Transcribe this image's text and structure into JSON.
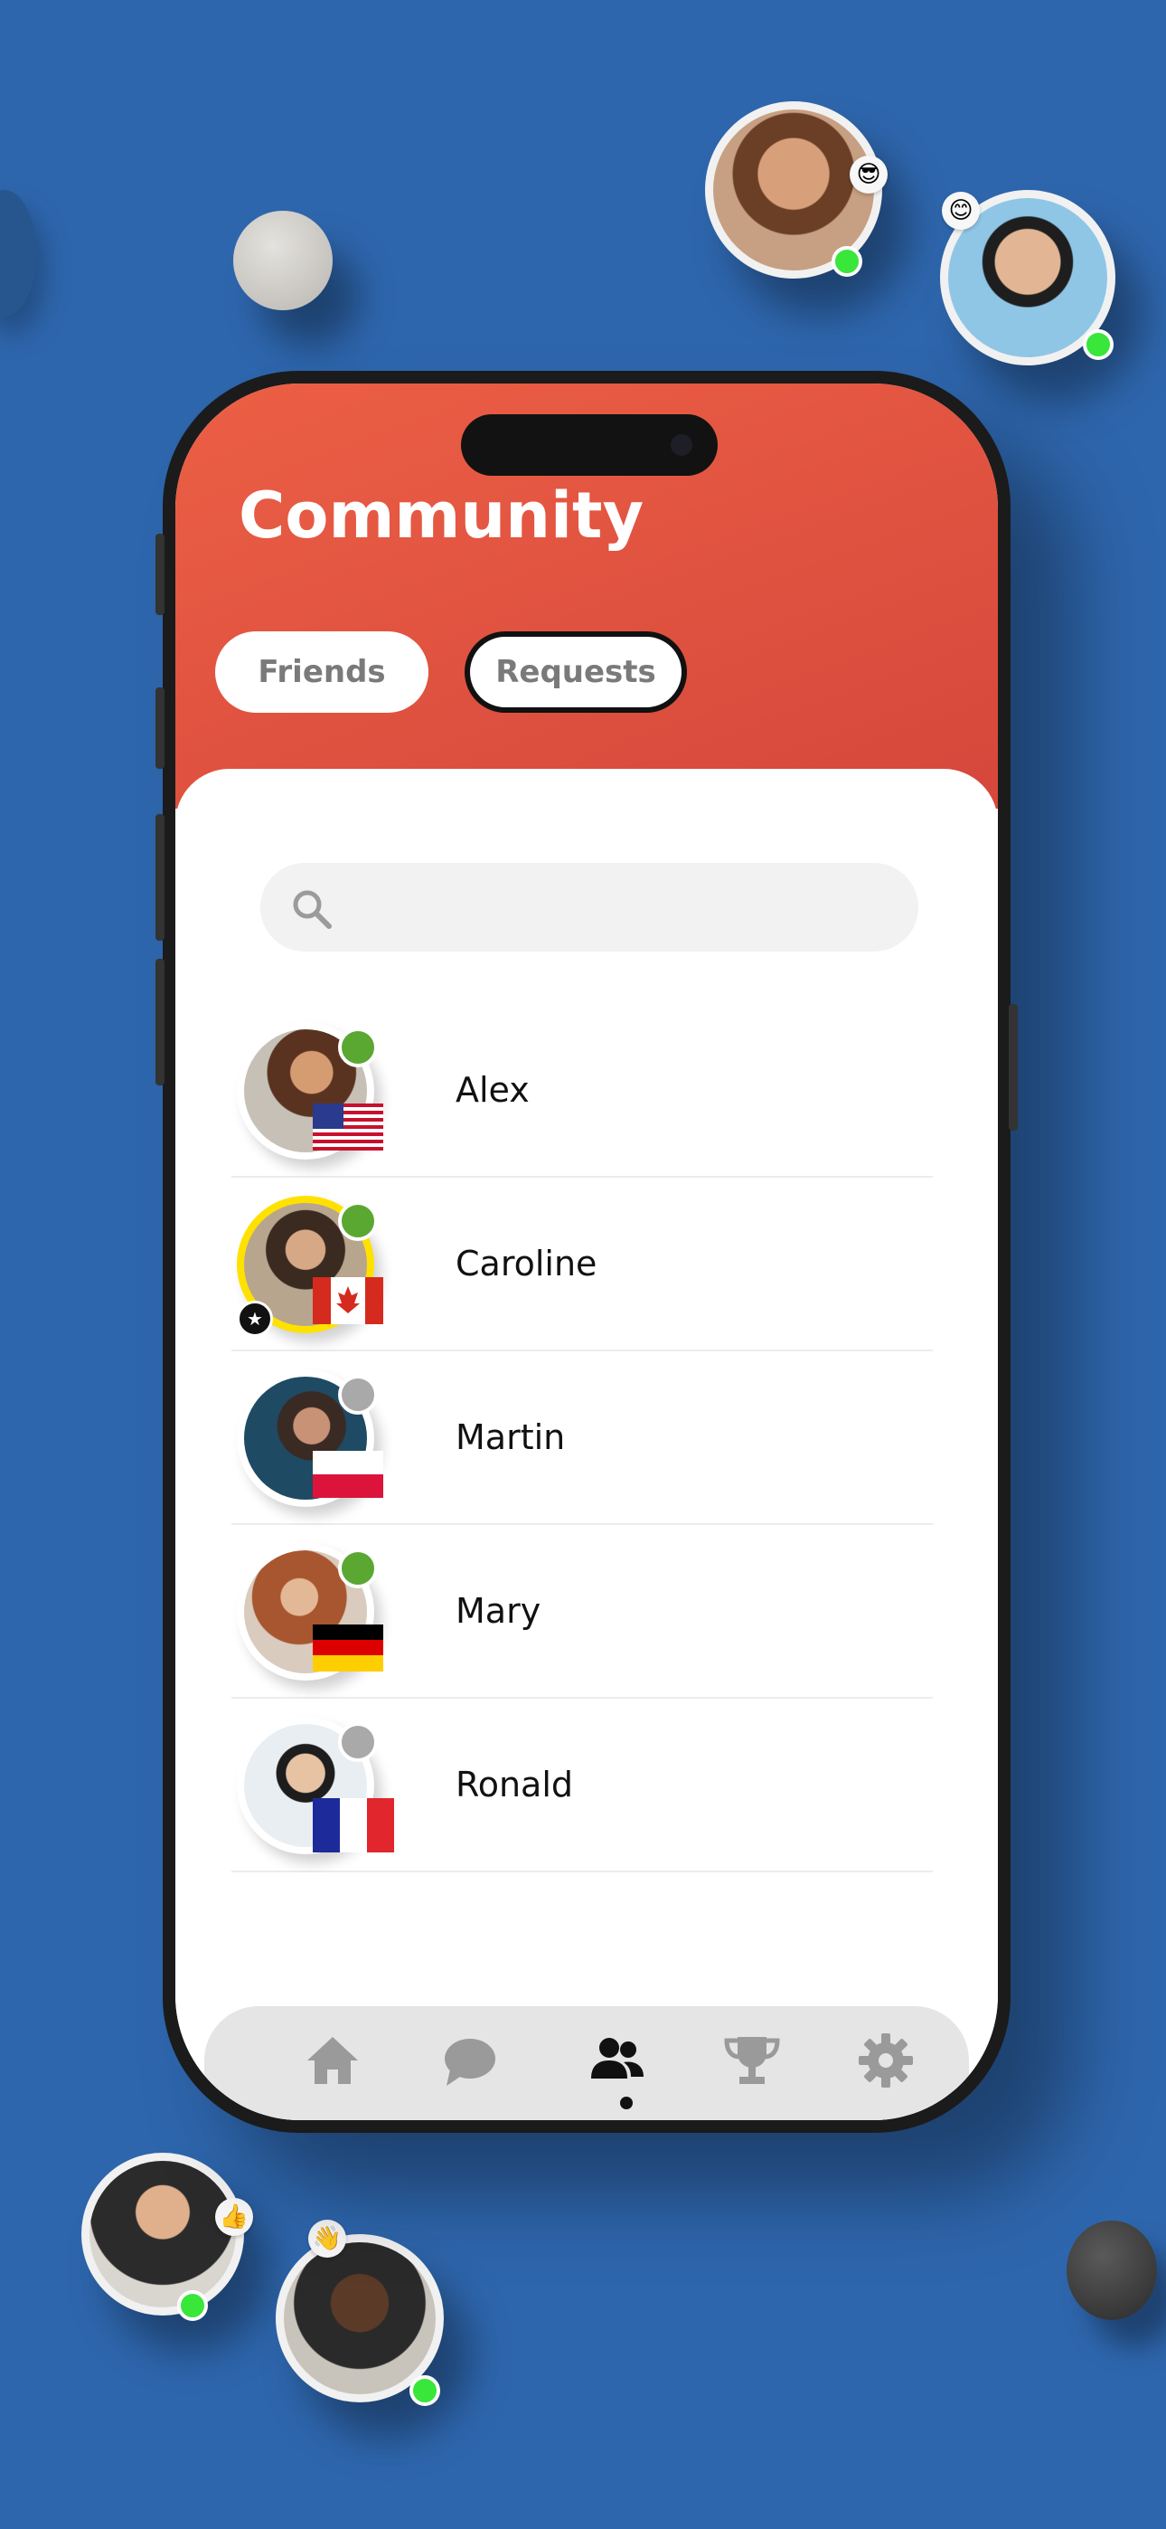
{
  "header": {
    "title": "Community"
  },
  "tabs": {
    "friends": "Friends",
    "requests": "Requests"
  },
  "search": {
    "placeholder": ""
  },
  "friends": [
    {
      "name": "Alex",
      "status": "online",
      "country": "United States",
      "flag_icon": "us-flag-icon"
    },
    {
      "name": "Caroline",
      "status": "online",
      "country": "Canada",
      "flag_icon": "canada-flag-icon",
      "premium": true
    },
    {
      "name": "Martin",
      "status": "offline",
      "country": "Poland",
      "flag_icon": "poland-flag-icon"
    },
    {
      "name": "Mary",
      "status": "online",
      "country": "Germany",
      "flag_icon": "germany-flag-icon"
    },
    {
      "name": "Ronald",
      "status": "offline",
      "country": "France",
      "flag_icon": "france-flag-icon"
    }
  ],
  "bottom_nav": {
    "items": [
      "home-icon",
      "chat-icon",
      "community-icon",
      "trophy-icon",
      "settings-icon"
    ],
    "active": "community-icon"
  },
  "floating_avatars": [
    {
      "emoji": "😎",
      "status": "online"
    },
    {
      "emoji": "😊",
      "status": "online"
    },
    {
      "emoji": "👍",
      "status": "online"
    },
    {
      "emoji": "👋",
      "status": "online"
    }
  ],
  "colors": {
    "background": "#2e66ad",
    "header": "#e0503e",
    "online": "#5aa832",
    "offline": "#a9a9a9",
    "premium_ring": "#ffe100"
  }
}
